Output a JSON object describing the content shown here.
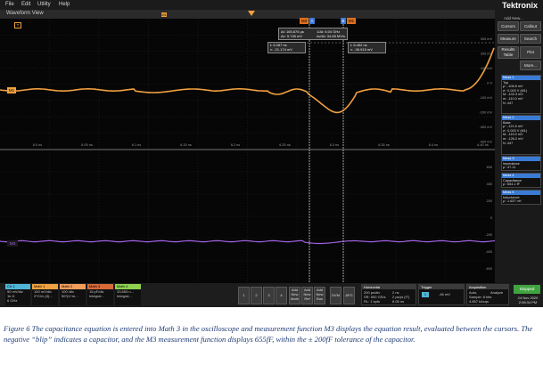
{
  "menu": [
    "File",
    "Edit",
    "Utility",
    "Help"
  ],
  "brand": {
    "name": "Tektronix",
    "subtitle": "Add New..."
  },
  "waveform_view": {
    "title": "Waveform View"
  },
  "markers": {
    "t_trigger": "T",
    "m1": "M1",
    "m3": "M3",
    "a_lbl": "A",
    "b_lbl": "B",
    "cursor_a": "a",
    "cursor_b": "b"
  },
  "cursor_readouts": {
    "delta": [
      "Δt: 165.875 µs",
      "Δv: 5.745 mV"
    ],
    "slope": [
      "1/Δt: 6.04 GHz",
      "Δv/Δt: 34.65 MV/s"
    ],
    "a": [
      "t: 6.287 ns",
      "v: -21.174 mV"
    ],
    "b": [
      "t: 6.452 ns",
      "v: -36.915 mV"
    ]
  },
  "right_buttons": {
    "cursors": "Cursors",
    "callout": "Callout",
    "measure": "Measure",
    "search": "Search",
    "results_table": "Results Table",
    "plot": "Plot",
    "more": "More..."
  },
  "upper_axis_ticks": [
    "300 mV",
    "200 mV",
    "100 mV",
    "0 V",
    "-100 mV",
    "-200 mV",
    "-300 mV",
    "-400 mV"
  ],
  "lower_axis_ticks": [
    "600",
    "400",
    "200",
    "0",
    "-200",
    "-400",
    "-600"
  ],
  "time_ticks": [
    "6.0 ns",
    "6.05 ns",
    "6.1 ns",
    "6.15 ns",
    "6.2 ns",
    "6.25 ns",
    "6.3 ns",
    "6.35 ns",
    "6.4 ns",
    "6.45 ns",
    "6.5 ns"
  ],
  "measurements": [
    {
      "name": "Meas 1",
      "lines": [
        "Top",
        "µ': -106.8 mV",
        "σ': 0.000 V (M1)",
        "M: -102.3 mV",
        "m: -110.0 mV",
        "N: 447"
      ]
    },
    {
      "name": "Meas 2",
      "lines": [
        "Base",
        "µ': -121.6 mV",
        "σ': 0.000 V (M1)",
        "M: -119.0 mV",
        "m: -126.2 mV",
        "N: 447"
      ]
    },
    {
      "name": "Meas 3",
      "lines": [
        "Impedance",
        "µ': 47.11"
      ]
    },
    {
      "name": "Meas 4",
      "lines": [
        "Capacitance",
        "µ': 654.1 fF"
      ]
    },
    {
      "name": "Meas 5",
      "lines": [
        "Inductance",
        "µ': 1.637 nH"
      ]
    }
  ],
  "channels": [
    {
      "name": "Ch 1",
      "lines": [
        "50 mV/div",
        "1k Ω",
        "6 GHz"
      ],
      "color": "#4fb5d6"
    },
    {
      "name": "Math 1",
      "lines": [
        "100 mV/div",
        "2*Ch1-(3)..."
      ],
      "color": "#f0a040"
    },
    {
      "name": "Math 2",
      "lines": [
        "100 /div",
        "50*(1+m..."
      ],
      "color": "#f29c5a"
    },
    {
      "name": "Math 3",
      "lines": [
        "15 pF/div",
        "Integral..."
      ],
      "color": "#d86a3a"
    },
    {
      "name": "Math 4",
      "lines": [
        "33.653 n...",
        "Integral..."
      ],
      "color": "#8fd14f"
    }
  ],
  "num_buttons": [
    "1",
    "2",
    "3",
    "4"
  ],
  "add_buttons": [
    "Add New Math",
    "Add New Ref",
    "Add New Bus"
  ],
  "other_buttons": [
    "DVM",
    "AFG"
  ],
  "horizontal": {
    "title": "Horizontal",
    "lines": [
      "200 ps/div",
      "SR: 500 GS/s",
      "RL: 1 kpts",
      "2 ns",
      "2 ps/pt (IT)",
      "6.05 ns"
    ]
  },
  "trigger": {
    "title": "Trigger",
    "level": "-46 mV"
  },
  "acquisition": {
    "title": "Acquisition",
    "lines": [
      "Auto,",
      "Sample: 8 bits",
      "4.857 kAcqs",
      "Analyze"
    ]
  },
  "stopped": "Stopped",
  "datetime": [
    "24 Nov 2020",
    "2:08:34 PM"
  ],
  "caption": "Figure 6 The capacitance equation is entered into Math 3 in the oscilloscope and measurement function M3 displays the equation result, evaluated between the cursors.  The negative “blip” indicates a capacitor, and the M3 measurement function displays 655fF, within the ± 200fF tolerance of the capacitor.",
  "colors": {
    "orange": "#f0a040",
    "purple": "#a060e0",
    "accent_blue": "#3a7bd5",
    "caption": "#1f3b73"
  }
}
